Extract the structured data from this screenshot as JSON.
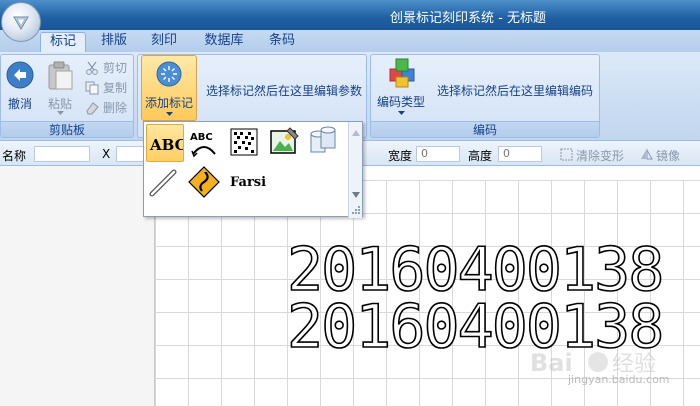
{
  "window": {
    "title": "创景标记刻印系统 - 无标题"
  },
  "tabs": [
    {
      "label": "标记",
      "active": true
    },
    {
      "label": "排版",
      "active": false
    },
    {
      "label": "刻印",
      "active": false
    },
    {
      "label": "数据库",
      "active": false
    },
    {
      "label": "条码",
      "active": false
    }
  ],
  "ribbon": {
    "clipboard": {
      "undo_label": "撤消",
      "paste_label": "粘贴",
      "cut_label": "剪切",
      "copy_label": "复制",
      "delete_label": "删除",
      "group_label": "剪贴板"
    },
    "mark": {
      "add_label": "添加标记",
      "hint": "选择标记然后在这里编辑参数"
    },
    "encode": {
      "type_label": "编码类型",
      "hint": "选择标记然后在这里编辑编码",
      "group_label": "编码"
    }
  },
  "dropdown": {
    "items": [
      "abc-text-icon",
      "arc-text-icon",
      "dot-matrix-icon",
      "image-icon",
      "cylinder-icon",
      "line-icon",
      "curve-icon"
    ],
    "farsi_label": "Farsi"
  },
  "propbar": {
    "name_label": "名称",
    "x_label": "X",
    "width_label": "宽度",
    "width_value": "0",
    "height_label": "高度",
    "height_value": "0",
    "clear_transform_label": "清除变形",
    "mirror_label": "镜像"
  },
  "canvas": {
    "lines": [
      "20160400138",
      "20160400138"
    ]
  },
  "watermark": {
    "text": "jingyan.baidu.com"
  }
}
